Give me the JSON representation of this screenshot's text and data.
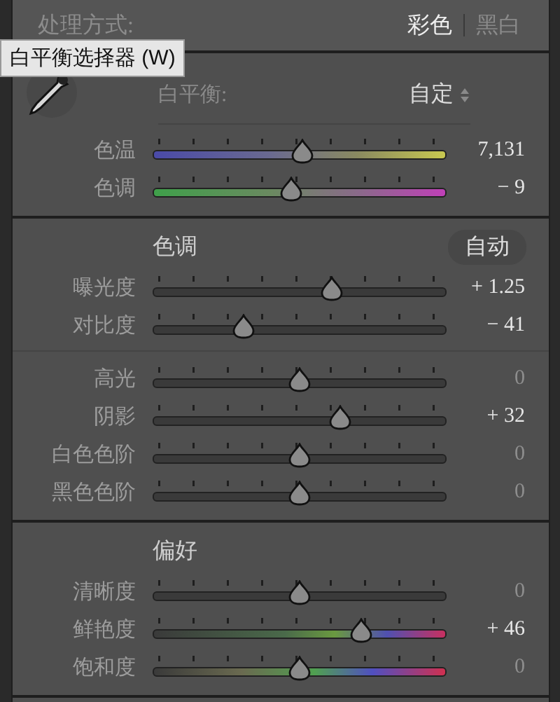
{
  "header": {
    "label": "处理方式:",
    "modes": [
      {
        "label": "彩色",
        "selected": true
      },
      {
        "label": "黑白",
        "selected": false
      }
    ]
  },
  "tooltip": "白平衡选择器 (W)",
  "sections": [
    {
      "white_balance": {
        "label": "白平衡:",
        "value": "自定"
      },
      "groups": [
        [
          {
            "label": "色温",
            "kind": "temperature",
            "level": 0.51,
            "reading": "7,131",
            "at_default": false
          },
          {
            "label": "色调",
            "kind": "tint",
            "level": 0.47,
            "reading": "− 9",
            "at_default": false
          }
        ]
      ]
    },
    {
      "title": "色调",
      "auto_button": "自动",
      "groups": [
        [
          {
            "label": "曝光度",
            "kind": "plain",
            "level": 0.61,
            "reading": "+ 1.25",
            "at_default": false
          },
          {
            "label": "对比度",
            "kind": "plain",
            "level": 0.31,
            "reading": "− 41",
            "at_default": false
          }
        ],
        [
          {
            "label": "高光",
            "kind": "plain",
            "level": 0.5,
            "reading": "0",
            "at_default": true
          },
          {
            "label": "阴影",
            "kind": "plain",
            "level": 0.64,
            "reading": "+ 32",
            "at_default": false
          },
          {
            "label": "白色色阶",
            "kind": "plain",
            "level": 0.5,
            "reading": "0",
            "at_default": true
          },
          {
            "label": "黑色色阶",
            "kind": "plain",
            "level": 0.5,
            "reading": "0",
            "at_default": true
          }
        ]
      ]
    },
    {
      "title": "偏好",
      "groups": [
        [
          {
            "label": "清晰度",
            "kind": "plain",
            "level": 0.5,
            "reading": "0",
            "at_default": true
          },
          {
            "label": "鲜艳度",
            "kind": "vibrance",
            "level": 0.71,
            "reading": "+ 46",
            "at_default": false
          },
          {
            "label": "饱和度",
            "kind": "saturation",
            "level": 0.5,
            "reading": "0",
            "at_default": true
          }
        ]
      ]
    }
  ]
}
